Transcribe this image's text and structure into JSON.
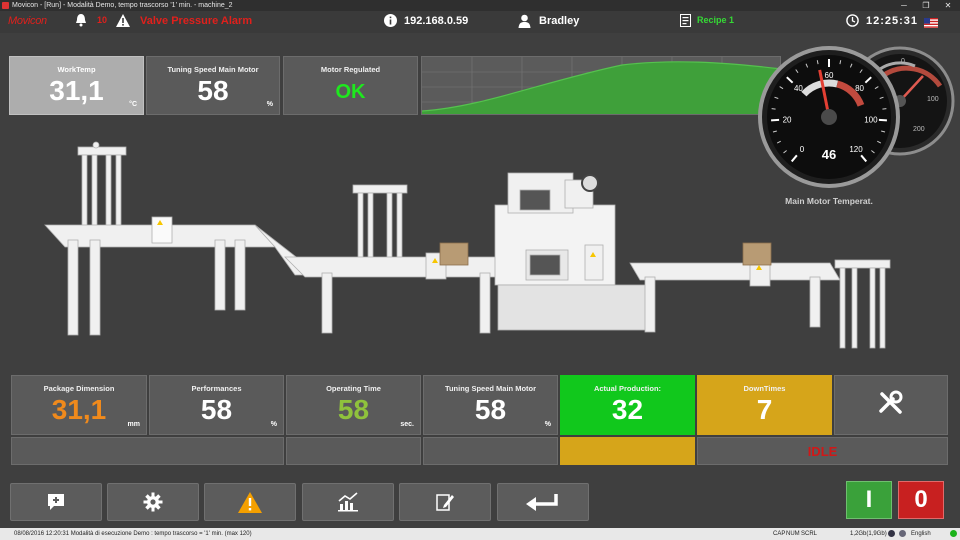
{
  "window": {
    "title": "Movicon - [Run] - Modalità Demo, tempo trascorso '1' min. - machine_2",
    "minimize": "─",
    "maximize": "❐",
    "close": "✕"
  },
  "header": {
    "logo": "Movicon",
    "alarm_count": "10",
    "alarm_text": "Valve Pressure Alarm",
    "ip_address": "192.168.0.59",
    "user": "Bradley",
    "recipe": "Recipe 1",
    "time": "12:25:31",
    "language_flag": "us-flag"
  },
  "top_tiles": [
    {
      "label": "WorkTemp",
      "value": "31,1",
      "unit": "°C"
    },
    {
      "label": "Tuning Speed Main Motor",
      "value": "58",
      "unit": "%"
    },
    {
      "label": "Motor Regulated",
      "value": "OK",
      "unit": ""
    }
  ],
  "gauge": {
    "label": "Main Motor Temperat.",
    "value": "46",
    "value_fraction": 0.46,
    "ticks": [
      "0",
      "20",
      "40",
      "60",
      "80",
      "100",
      "120"
    ],
    "back_ticks": [
      "0",
      "100",
      "200"
    ]
  },
  "bottom_tiles": [
    {
      "label": "Package Dimension",
      "value": "31,1",
      "unit": "mm",
      "color": "#f08a1c"
    },
    {
      "label": "Performances",
      "value": "58",
      "unit": "%",
      "color": "#ffffff"
    },
    {
      "label": "Operating Time",
      "value": "58",
      "unit": "sec.",
      "color": "#8fc23c"
    },
    {
      "label": "Tuning Speed Main Motor",
      "value": "58",
      "unit": "%",
      "color": "#ffffff"
    }
  ],
  "production": {
    "label": "Actual Production:",
    "value": "32",
    "color": "#11c81c"
  },
  "downtimes": {
    "label": "DownTimes",
    "value": "7",
    "color": "#d6a51a"
  },
  "machine_state": "IDLE",
  "start_button": "I",
  "stop_button": "0",
  "statusbar": {
    "message": "08/08/2016 12:20:31 Modalità di esecuzione Demo : tempo trascorso = '1' min. (max 120)",
    "caps": "CAP",
    "num": "NUM",
    "scrl": "SCRL",
    "memory": "1,2Gb(1,9Gb)",
    "language": "English"
  },
  "colors": {
    "alarm_red": "#e0201c",
    "ok_green": "#1ee81e",
    "recipe_green": "#35d935",
    "idle_red": "#d01818",
    "warning_orange": "#f5a000"
  }
}
